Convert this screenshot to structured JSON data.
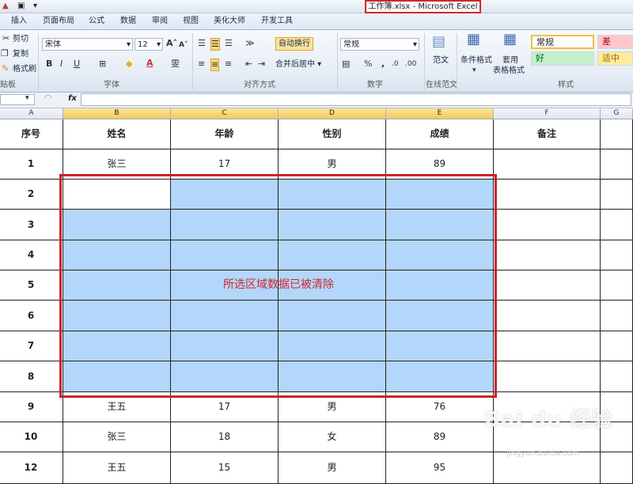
{
  "window": {
    "title": "工作簿.xlsx - Microsoft Excel"
  },
  "tabs": [
    "插入",
    "页面布局",
    "公式",
    "数据",
    "审阅",
    "视图",
    "美化大师",
    "开发工具"
  ],
  "ribbon": {
    "clipboard": {
      "cut": "剪切",
      "copy": "复制",
      "format_painter": "格式刷",
      "group": "贴板"
    },
    "font": {
      "name": "宋体",
      "size": "12",
      "group": "字体",
      "bold": "B",
      "italic": "I",
      "underline": "U"
    },
    "alignment": {
      "wrap": "自动换行",
      "merge": "合并后居中",
      "group": "对齐方式"
    },
    "number": {
      "format": "常规",
      "percent": "%",
      "comma": ",",
      "group": "数字"
    },
    "template": {
      "label": "范文",
      "group": "在线范文"
    },
    "styles": {
      "conditional": "条件格式",
      "table": "套用",
      "table2": "表格格式",
      "normal": "常规",
      "bad": "差",
      "good": "好",
      "neutral": "适中",
      "group": "样式"
    }
  },
  "formula_bar": {
    "fx": "fx",
    "value": ""
  },
  "columns": [
    "A",
    "B",
    "C",
    "D",
    "E",
    "F",
    "G"
  ],
  "headers": [
    "序号",
    "姓名",
    "年龄",
    "性别",
    "成绩",
    "备注"
  ],
  "rows": [
    [
      "1",
      "张三",
      "17",
      "男",
      "89",
      ""
    ],
    [
      "2",
      "",
      "",
      "",
      "",
      ""
    ],
    [
      "3",
      "",
      "",
      "",
      "",
      ""
    ],
    [
      "4",
      "",
      "",
      "",
      "",
      ""
    ],
    [
      "5",
      "",
      "",
      "",
      "",
      ""
    ],
    [
      "6",
      "",
      "",
      "",
      "",
      ""
    ],
    [
      "7",
      "",
      "",
      "",
      "",
      ""
    ],
    [
      "8",
      "",
      "",
      "",
      "",
      ""
    ],
    [
      "9",
      "王五",
      "17",
      "男",
      "76",
      ""
    ],
    [
      "10",
      "张三",
      "18",
      "女",
      "89",
      ""
    ],
    [
      "12",
      "王五",
      "15",
      "男",
      "95",
      ""
    ]
  ],
  "annotation": "所选区域数据已被清除",
  "watermark": {
    "brand": "Bai du 经验",
    "sub": "jingyan.baidu.com"
  },
  "colors": {
    "selection": "#b3d6fb",
    "highlight": "#d0282a",
    "accent": "#f5c85a"
  }
}
